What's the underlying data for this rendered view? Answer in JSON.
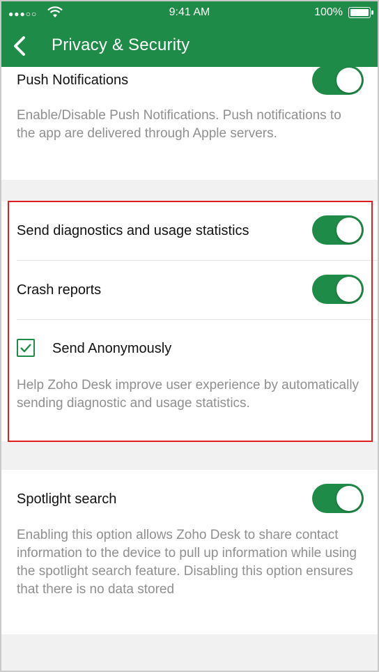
{
  "status_bar": {
    "signal": "●●●○○",
    "time": "9:41 AM",
    "battery": "100%"
  },
  "nav": {
    "title": "Privacy & Security",
    "back_icon": "chevron-left-icon"
  },
  "colors": {
    "accent": "#1f8b48",
    "highlight_border": "#e01e1e",
    "description_text": "#8f8f8f",
    "background": "#f1f1f1"
  },
  "settings": {
    "push": {
      "label": "Push Notifications",
      "enabled": true,
      "description": "Enable/Disable Push Notifications. Push notifications to the app are delivered through Apple servers."
    },
    "diagnostics": {
      "label": "Send diagnostics and usage statistics",
      "enabled": true
    },
    "crash": {
      "label": "Crash reports",
      "enabled": true
    },
    "anonymous": {
      "label": "Send Anonymously",
      "checked": true,
      "description": "Help Zoho Desk improve user experience by automatically sending diagnostic and usage statistics."
    },
    "spotlight": {
      "label": "Spotlight search",
      "enabled": true,
      "description": "Enabling this option allows Zoho Desk to share contact information to the device to pull up information while using the spotlight search feature. Disabling this option ensures that there is no data stored"
    }
  }
}
